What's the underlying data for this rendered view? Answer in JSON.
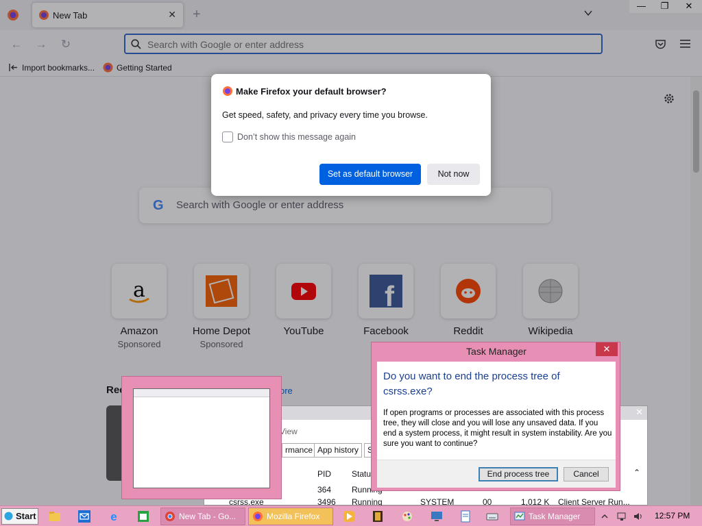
{
  "browser": {
    "tab_title": "New Tab",
    "url_placeholder": "Search with Google or enter address",
    "bookmarks": [
      "Import bookmarks...",
      "Getting Started"
    ]
  },
  "newtab": {
    "search_placeholder": "Search with Google or enter address",
    "sites": [
      {
        "name": "Amazon",
        "sponsored": "Sponsored"
      },
      {
        "name": "Home Depot",
        "sponsored": "Sponsored"
      },
      {
        "name": "YouTube",
        "sponsored": ""
      },
      {
        "name": "Facebook",
        "sponsored": ""
      },
      {
        "name": "Reddit",
        "sponsored": ""
      },
      {
        "name": "Wikipedia",
        "sponsored": ""
      }
    ],
    "recent_label": "Rec",
    "recent_more": "ore"
  },
  "default_dialog": {
    "title": "Make Firefox your default browser?",
    "body": "Get speed, safety, and privacy every time you browse.",
    "checkbox_label": "Don’t show this message again",
    "primary": "Set as default browser",
    "secondary": "Not now"
  },
  "task_manager_back": {
    "menu_view": "View",
    "tabs": [
      "rmance",
      "App history",
      "S"
    ],
    "headers": {
      "pid": "PID",
      "status": "Statu"
    },
    "rows": [
      {
        "name": "",
        "pid": "364",
        "status": "Running",
        "user": "",
        "cpu": "",
        "mem": "",
        "desc": ""
      },
      {
        "name": "csrss.exe",
        "pid": "3496",
        "status": "Running",
        "user": "SYSTEM",
        "cpu": "00",
        "mem": "1,012 K",
        "desc": "Client Server Run..."
      }
    ]
  },
  "confirm_dialog": {
    "title": "Task Manager",
    "close": "✕",
    "question": "Do you want to end the process tree of csrss.exe?",
    "message": "If open programs or processes are associated with this process tree, they will close and you will lose any unsaved data. If you end a system process, it might result in system instability. Are you sure you want to continue?",
    "primary": "End process tree",
    "cancel": "Cancel"
  },
  "taskbar": {
    "start": "Start",
    "buttons": [
      "New Tab - Go...",
      "Mozilla Firefox",
      "Task Manager"
    ],
    "clock": "12:57 PM"
  },
  "colors": {
    "accent": "#0061e0",
    "taskbar": "#e9a4c4",
    "dialog_frame": "#e78fb5"
  }
}
